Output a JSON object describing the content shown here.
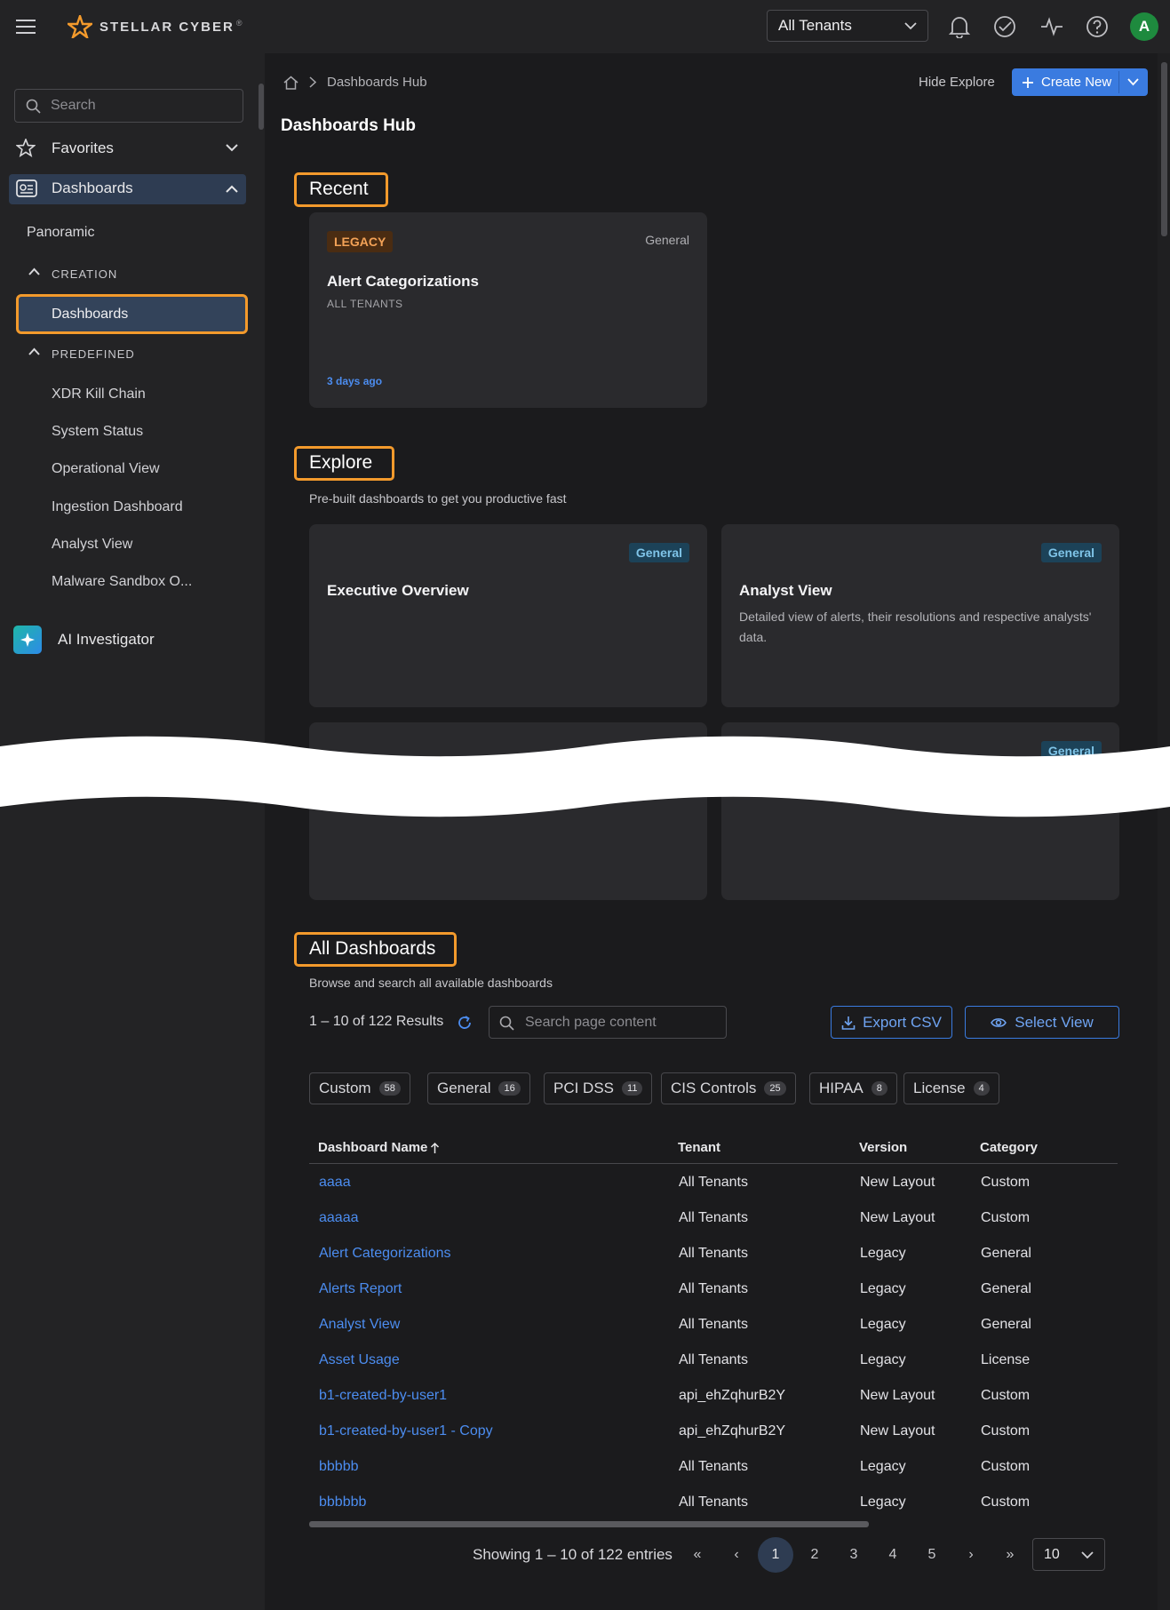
{
  "header": {
    "brand": "STELLAR CYBER",
    "tenant_select": "All Tenants",
    "avatar_initial": "A"
  },
  "sidebar": {
    "search_placeholder": "Search",
    "favorites": "Favorites",
    "dashboards": "Dashboards",
    "panoramic": "Panoramic",
    "creation_caption": "CREATION",
    "creation_item": "Dashboards",
    "predefined_caption": "PREDEFINED",
    "predefined_items": [
      "XDR Kill Chain",
      "System Status",
      "Operational View",
      "Ingestion Dashboard",
      "Analyst View",
      "Malware Sandbox O..."
    ],
    "ai_investigator": "AI Investigator"
  },
  "main": {
    "breadcrumb": "Dashboards Hub",
    "page_title": "Dashboards Hub",
    "hide_explore": "Hide Explore",
    "create_new": "Create New",
    "recent": {
      "title": "Recent",
      "card": {
        "badge": "LEGACY",
        "category": "General",
        "name": "Alert Categorizations",
        "tenant": "ALL TENANTS",
        "time": "3 days ago"
      }
    },
    "explore": {
      "title": "Explore",
      "subtitle": "Pre-built dashboards to get you productive fast",
      "cards": [
        {
          "badge": "General",
          "name": "Executive Overview",
          "desc": ""
        },
        {
          "badge": "General",
          "name": "Analyst View",
          "desc": "Detailed view of alerts, their resolutions and respective analysts' data."
        },
        {
          "badge": "",
          "name": "",
          "desc": ""
        },
        {
          "badge": "General",
          "name": "",
          "desc": ""
        }
      ]
    },
    "all": {
      "title": "All Dashboards",
      "subtitle": "Browse and search all available dashboards",
      "results": "1 – 10 of 122 Results",
      "search_placeholder": "Search page content",
      "export_csv": "Export CSV",
      "select_view": "Select View",
      "chips": [
        {
          "label": "Custom",
          "count": "58"
        },
        {
          "label": "General",
          "count": "16"
        },
        {
          "label": "PCI DSS",
          "count": "11"
        },
        {
          "label": "CIS Controls",
          "count": "25"
        },
        {
          "label": "HIPAA",
          "count": "8"
        },
        {
          "label": "License",
          "count": "4"
        }
      ],
      "columns": [
        "Dashboard Name",
        "Tenant",
        "Version",
        "Category"
      ],
      "rows": [
        [
          "aaaa",
          "All Tenants",
          "New Layout",
          "Custom"
        ],
        [
          "aaaaa",
          "All Tenants",
          "New Layout",
          "Custom"
        ],
        [
          "Alert Categorizations",
          "All Tenants",
          "Legacy",
          "General"
        ],
        [
          "Alerts Report",
          "All Tenants",
          "Legacy",
          "General"
        ],
        [
          "Analyst View",
          "All Tenants",
          "Legacy",
          "General"
        ],
        [
          "Asset Usage",
          "All Tenants",
          "Legacy",
          "License"
        ],
        [
          "b1-created-by-user1",
          "api_ehZqhurB2Y",
          "New Layout",
          "Custom"
        ],
        [
          "b1-created-by-user1 - Copy",
          "api_ehZqhurB2Y",
          "New Layout",
          "Custom"
        ],
        [
          "bbbbb",
          "All Tenants",
          "Legacy",
          "Custom"
        ],
        [
          "bbbbbb",
          "All Tenants",
          "Legacy",
          "Custom"
        ]
      ],
      "pagination": {
        "showing": "Showing 1 – 10 of 122 entries",
        "pages": [
          "1",
          "2",
          "3",
          "4",
          "5"
        ],
        "current": "1",
        "page_size": "10"
      }
    }
  },
  "colors": {
    "accent": "#3a7be0",
    "highlight": "#f39a2c",
    "link": "#4c8df0"
  }
}
